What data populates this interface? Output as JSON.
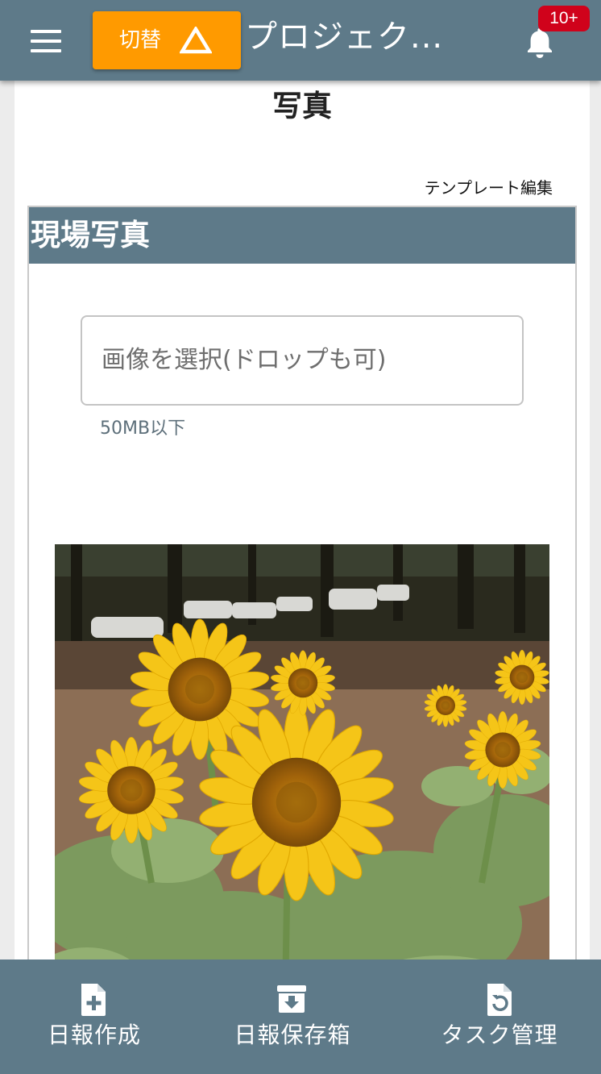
{
  "header": {
    "switch_label": "切替",
    "project_title": "プロジェク...",
    "notification_count": "10+"
  },
  "page": {
    "title": "写真",
    "template_edit_link": "テンプレート編集"
  },
  "section": {
    "title": "現場写真",
    "file_input_placeholder": "画像を選択(ドロップも可)",
    "size_limit": "50MB以下"
  },
  "bottom_nav": {
    "items": [
      {
        "label": "日報作成",
        "icon": "file-plus-icon"
      },
      {
        "label": "日報保存箱",
        "icon": "archive-icon"
      },
      {
        "label": "タスク管理",
        "icon": "task-refresh-icon"
      }
    ]
  },
  "colors": {
    "bar": "#5e7a89",
    "switch_button": "#ff9a00",
    "badge": "#d0021b"
  }
}
